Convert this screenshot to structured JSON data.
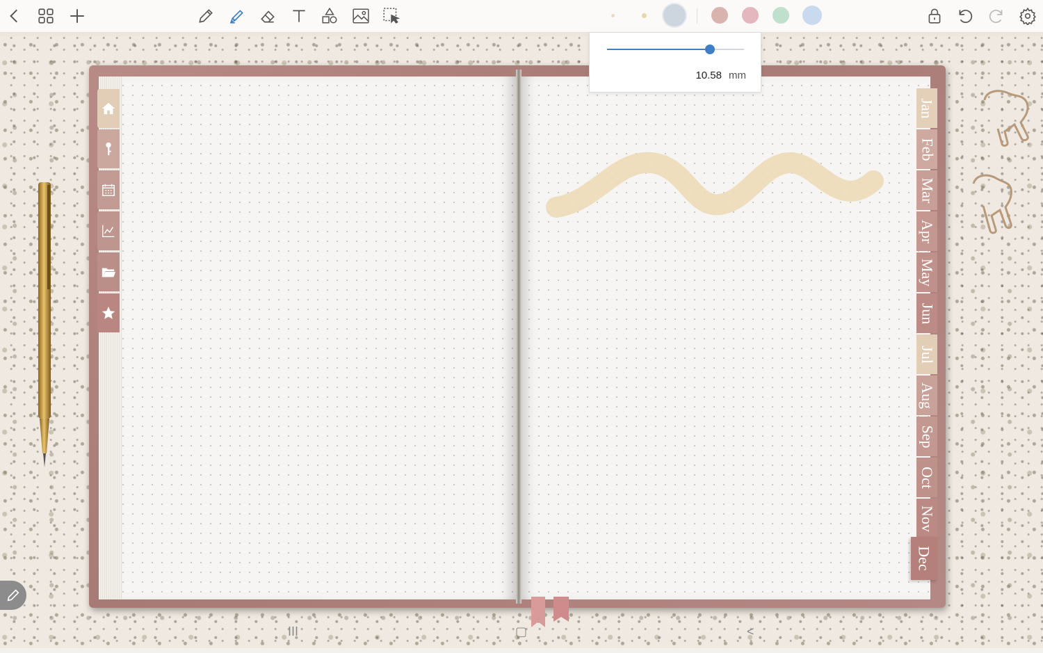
{
  "toolbar": {
    "left_icons": [
      "back-icon",
      "grid-icon",
      "add-icon"
    ],
    "tools": [
      "pen-icon",
      "highlighter-icon",
      "eraser-icon",
      "text-icon",
      "shapes-icon",
      "image-icon",
      "lasso-select-icon"
    ],
    "active_tool": "highlighter-icon",
    "right_icons": [
      "lock-icon",
      "undo-icon",
      "redo-icon",
      "settings-icon"
    ]
  },
  "colors": {
    "swatches": [
      "#e8dcc0",
      "#e8d8a8",
      "#cdd6de",
      "#d9b3ad",
      "#e4b7be",
      "#bfe0cc",
      "#c9daef"
    ],
    "selected_swatch": "#cdd6de",
    "accent": "#3f7fc6",
    "stroke": "#eddcb8",
    "tab_pink": "#b98682",
    "tab_active": "#e2cdb6"
  },
  "size_popover": {
    "value": "10.58",
    "unit": "mm",
    "slider_fraction": 0.75
  },
  "planner": {
    "side_tabs": [
      "home-icon",
      "key-icon",
      "calendar-icon",
      "chart-icon",
      "folder-icon",
      "star-icon"
    ],
    "months": [
      "Jan",
      "Feb",
      "Mar",
      "Apr",
      "May",
      "Jun",
      "Jul",
      "Aug",
      "Sep",
      "Oct",
      "Nov",
      "Dec"
    ],
    "active_month": "Jul",
    "selected_month": "Dec"
  },
  "system_nav": {
    "recents": "III",
    "home": "▢",
    "back": "<"
  }
}
